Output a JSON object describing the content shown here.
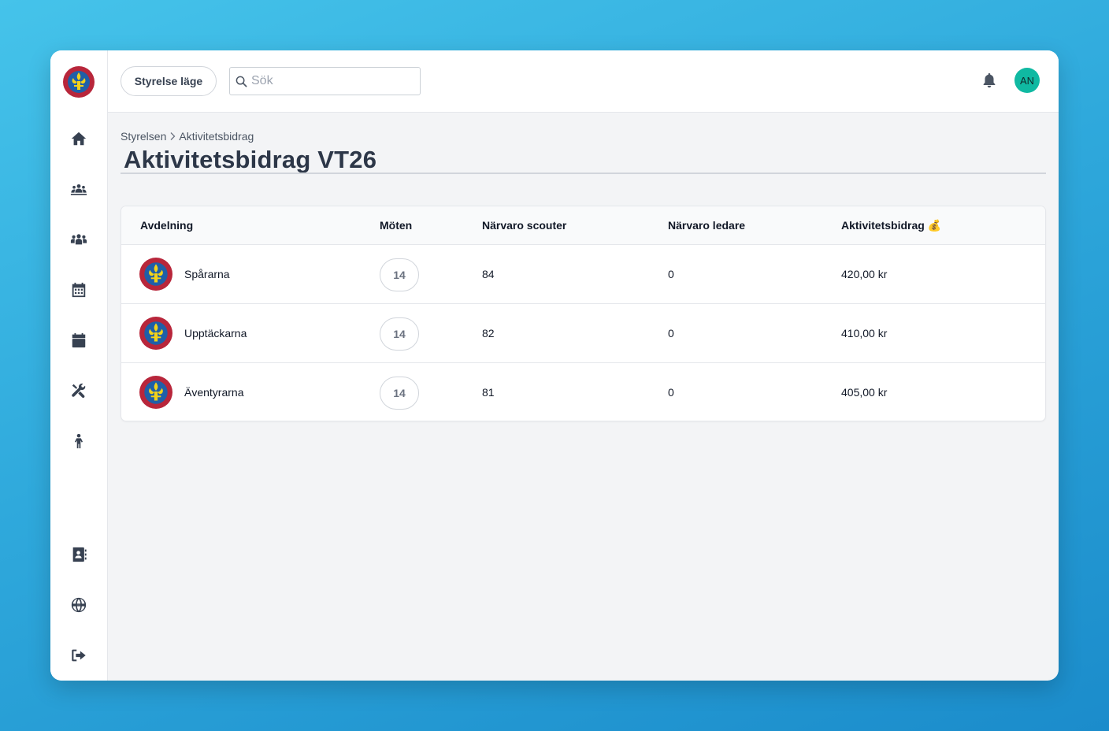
{
  "topbar": {
    "mode_button": "Styrelse läge",
    "search_placeholder": "Sök",
    "avatar_initials": "AN"
  },
  "breadcrumb": {
    "items": [
      "Styrelsen",
      "Aktivitetsbidrag"
    ]
  },
  "page": {
    "title": "Aktivitetsbidrag VT26"
  },
  "sidebar": {
    "icons": [
      "home-icon",
      "group-icon",
      "people-icon",
      "calendar-grid-icon",
      "calendar-icon",
      "tools-icon",
      "person-icon",
      "contact-book-icon",
      "globe-icon",
      "logout-icon"
    ]
  },
  "table": {
    "headers": [
      "Avdelning",
      "Möten",
      "Närvaro scouter",
      "Närvaro ledare",
      "Aktivitetsbidrag 💰"
    ],
    "rows": [
      {
        "name": "Spårarna",
        "meetings": "14",
        "scouts": "84",
        "leaders": "0",
        "grant": "420,00 kr"
      },
      {
        "name": "Upptäckarna",
        "meetings": "14",
        "scouts": "82",
        "leaders": "0",
        "grant": "410,00 kr"
      },
      {
        "name": "Äventyrarna",
        "meetings": "14",
        "scouts": "81",
        "leaders": "0",
        "grant": "405,00 kr"
      }
    ]
  },
  "colors": {
    "accent_avatar": "#10b9a2",
    "background_gradient_start": "#45c3ea",
    "background_gradient_end": "#1b8ccb"
  }
}
